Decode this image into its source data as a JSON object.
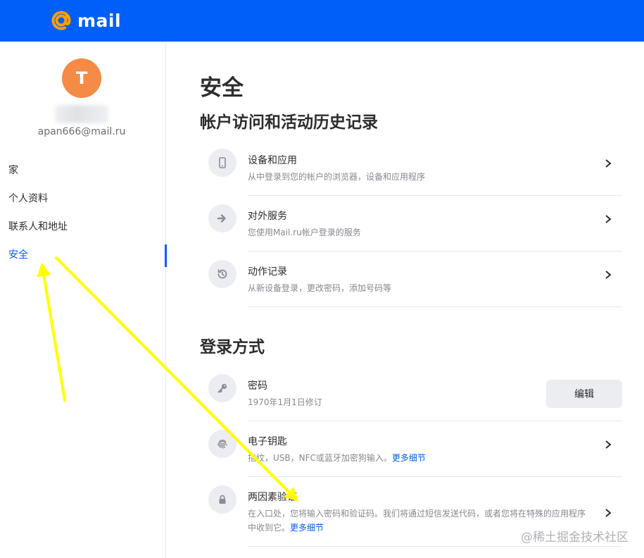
{
  "brand": {
    "logo_text": "mail",
    "color": "#005ff9",
    "logo_accent": "#ff9e00"
  },
  "sidebar": {
    "avatar_letter": "T",
    "avatar_color": "#f58b44",
    "email": "apan666@mail.ru",
    "items": [
      {
        "label": "家",
        "active": false
      },
      {
        "label": "个人资料",
        "active": false
      },
      {
        "label": "联系人和地址",
        "active": false
      },
      {
        "label": "安全",
        "active": true
      }
    ]
  },
  "main": {
    "title": "安全",
    "sections": [
      {
        "title": "帐户访问和活动历史记录",
        "rows": [
          {
            "icon": "device-icon",
            "title": "设备和应用",
            "desc": "从中登录到您的帐户的浏览器，设备和应用程序"
          },
          {
            "icon": "arrow-right-icon",
            "title": "对外服务",
            "desc": "您使用Mail.ru帐户登录的服务"
          },
          {
            "icon": "history-icon",
            "title": "动作记录",
            "desc": "从新设备登录，更改密码，添加号码等"
          }
        ]
      },
      {
        "title": "登录方式",
        "rows": [
          {
            "icon": "key-icon",
            "title": "密码",
            "desc": "1970年1月1日修订",
            "action": "编辑"
          },
          {
            "icon": "fingerprint-icon",
            "title": "电子钥匙",
            "desc": "指纹，USB，NFC或蓝牙加密狗输入。",
            "link": "更多细节"
          },
          {
            "icon": "lock-icon",
            "title": "两因素验证",
            "desc": "在入口处，您将输入密码和验证码。我们将通过短信发送代码，或者您将在特殊的应用程序中收到它。",
            "link": "更多细节"
          }
        ]
      }
    ]
  },
  "watermark": "@稀土掘金技术社区",
  "annotation_color": "#ffff00"
}
